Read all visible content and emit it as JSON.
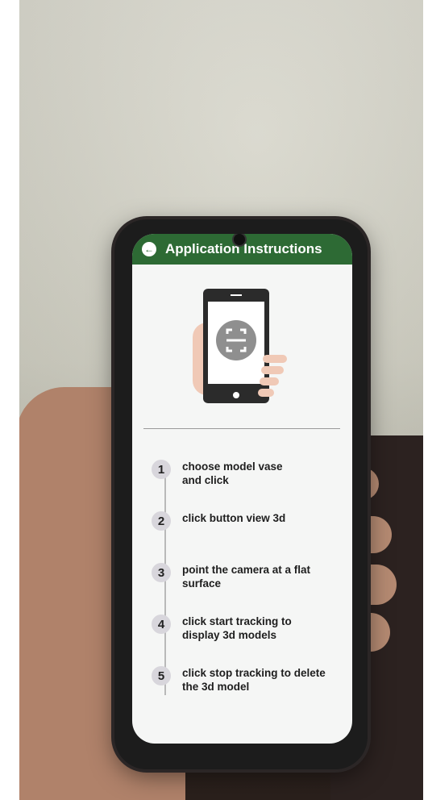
{
  "header": {
    "title": "Application Instructions"
  },
  "illustration": {
    "icon": "scan-phone-illustration"
  },
  "steps": [
    {
      "number": "1",
      "text": "choose model vase and click"
    },
    {
      "number": "2",
      "text": "click button view 3d"
    },
    {
      "number": "3",
      "text": "point the camera at a flat surface"
    },
    {
      "number": "4",
      "text": "click start tracking to display 3d models"
    },
    {
      "number": "5",
      "text": "click stop tracking to delete the 3d model"
    }
  ],
  "colors": {
    "header": "#2d6a34",
    "step_badge": "#d8d6dc"
  }
}
